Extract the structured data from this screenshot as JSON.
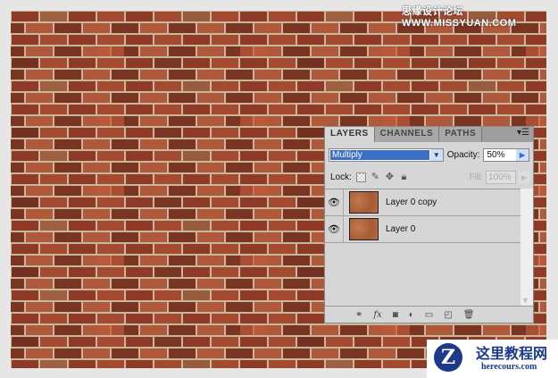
{
  "watermark_top": "思缘设计论坛 WWW.MISSYUAN.COM",
  "logo": {
    "cn": "这里教程网",
    "en": "herecours.com",
    "letter": "Z"
  },
  "panel": {
    "tabs": [
      {
        "label": "LAYERS",
        "active": true
      },
      {
        "label": "CHANNELS"
      },
      {
        "label": "PATHS"
      }
    ],
    "blend_mode": "Multiply",
    "opacity_label": "Opacity:",
    "opacity": "50%",
    "lock_label": "Lock:",
    "fill_label": "Fill:",
    "fill": "100%",
    "layers": [
      {
        "name": "Layer 0 copy",
        "visible": true
      },
      {
        "name": "Layer 0",
        "visible": true
      }
    ]
  },
  "colors": {
    "brick": "#8a3a28",
    "mortar": "#c9b79c",
    "panel": "#d6d6d6",
    "selection": "#3a6fc8"
  }
}
